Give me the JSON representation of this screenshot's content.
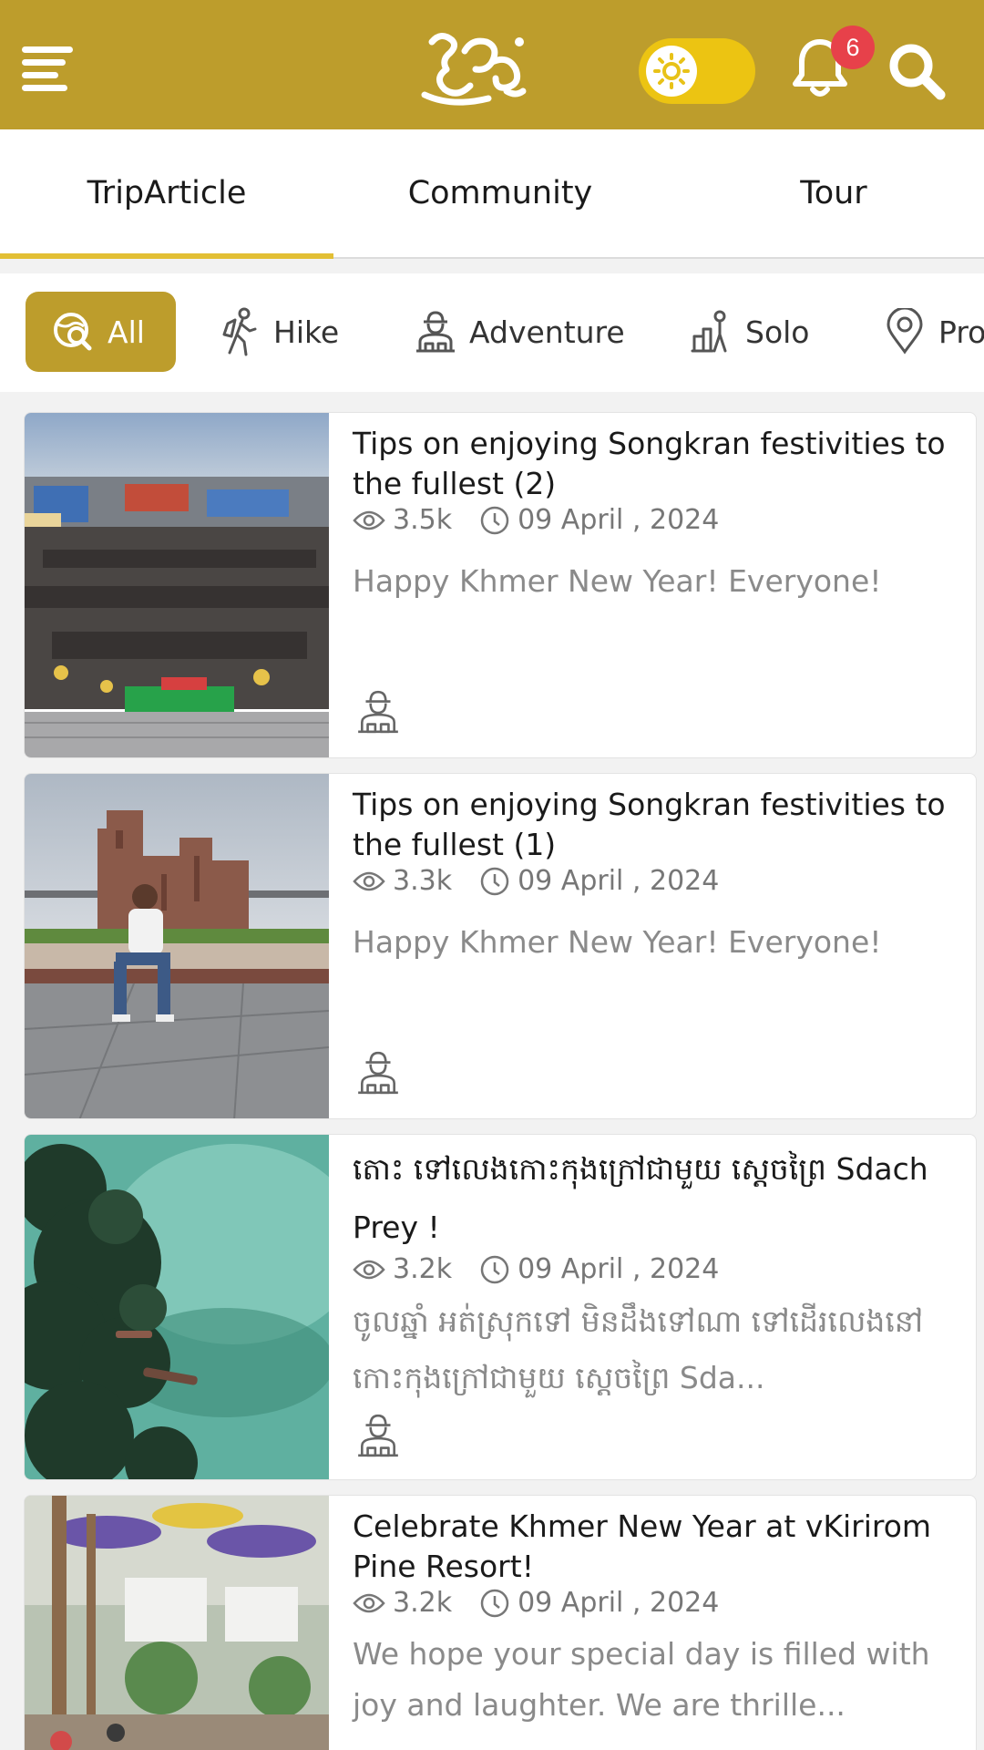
{
  "header": {
    "badge_count": "6",
    "accent_color": "#bd9d2c",
    "icons": [
      "menu-icon",
      "app-logo",
      "theme-toggle-sun-icon",
      "bell-icon",
      "search-icon"
    ]
  },
  "tabs": [
    "TripArticle",
    "Community",
    "Tour"
  ],
  "filters": [
    {
      "label": "All",
      "icon": "globe-search-icon",
      "active": true
    },
    {
      "label": "Hike",
      "icon": "hiker-icon",
      "active": false
    },
    {
      "label": "Adventure",
      "icon": "explorer-icon",
      "active": false
    },
    {
      "label": "Solo",
      "icon": "solo-traveler-icon",
      "active": false
    },
    {
      "label": "Pro",
      "icon": "location-pin-icon",
      "active": false
    }
  ],
  "articles": [
    {
      "title": "Tips on enjoying Songkran festivities to the fullest (2)",
      "views": "3.5k",
      "date": "09 April , 2024",
      "excerpt": "Happy Khmer New Year! Everyone!",
      "category_icon": "explorer-icon"
    },
    {
      "title": "Tips on enjoying Songkran festivities to the fullest (1)",
      "views": "3.3k",
      "date": "09 April , 2024",
      "excerpt": "Happy Khmer New Year! Everyone!",
      "category_icon": "explorer-icon"
    },
    {
      "title": "តោះ ទៅលេងកោះកុងក្រៅជាមួយ ស្តេចព្រៃ Sdach Prey !",
      "views": "3.2k",
      "date": "09 April , 2024",
      "excerpt": "ចូលឆ្នាំ អត់ស្រុកទៅ  មិនដឹងទៅណា ទៅដើរលេងនៅកោះកុងក្រៅជាមួយ ស្តេចព្រៃ Sda...",
      "category_icon": "explorer-icon"
    },
    {
      "title": "Celebrate Khmer New Year at vKirirom Pine Resort!",
      "views": "3.2k",
      "date": "09 April , 2024",
      "excerpt": "We hope your special day is filled with joy and laughter.  We are thrille...",
      "category_icon": "explorer-icon"
    }
  ]
}
